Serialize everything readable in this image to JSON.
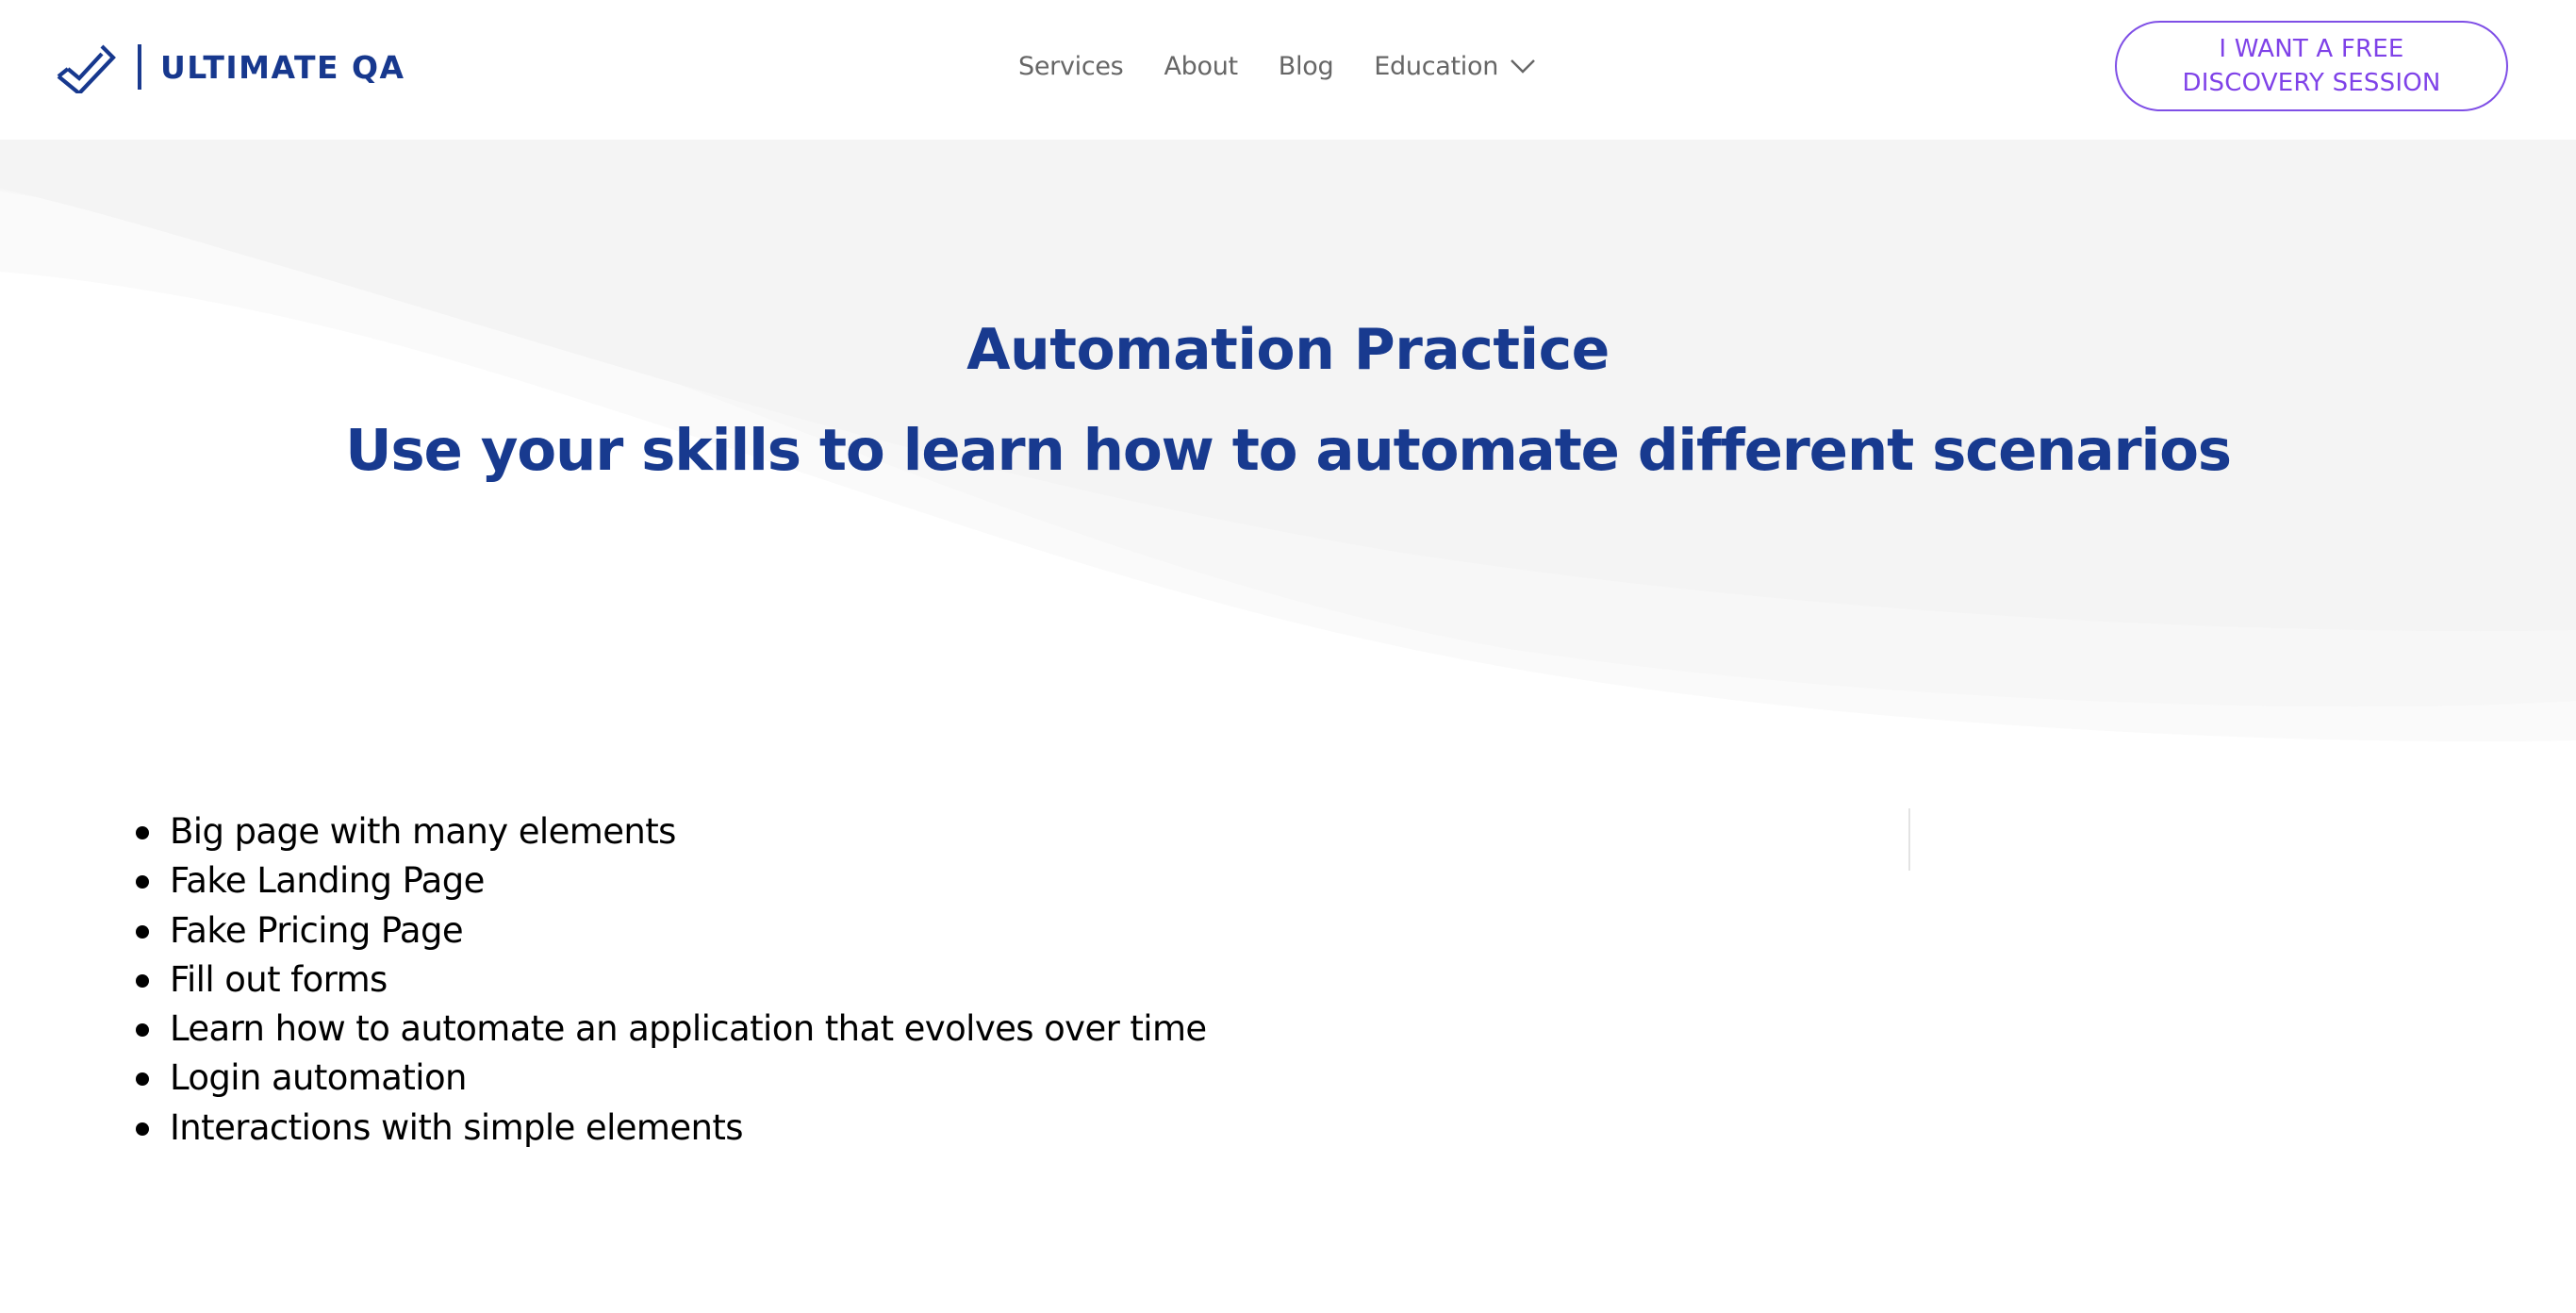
{
  "header": {
    "logo": {
      "text": "ULTIMATE QA",
      "icon": "checkmark-icon",
      "color": "#17388e"
    },
    "nav": [
      {
        "label": "Services"
      },
      {
        "label": "About"
      },
      {
        "label": "Blog"
      },
      {
        "label": "Education",
        "icon": "chevron-down-icon"
      }
    ],
    "cta": {
      "line1": "I WANT A FREE",
      "line2": "DISCOVERY SESSION",
      "color": "#7f42e8"
    }
  },
  "hero": {
    "title": "Automation Practice",
    "subtitle": "Use your skills to learn how to automate different scenarios",
    "text_color": "#183a8f",
    "background": "#f4f4f4"
  },
  "practice": {
    "items": [
      {
        "label": "Big page with many elements"
      },
      {
        "label": "Fake Landing Page"
      },
      {
        "label": "Fake Pricing Page"
      },
      {
        "label": "Fill out forms"
      },
      {
        "label": "Learn how to automate an application that evolves over time"
      },
      {
        "label": "Login automation"
      },
      {
        "label": "Interactions with simple elements"
      }
    ]
  }
}
